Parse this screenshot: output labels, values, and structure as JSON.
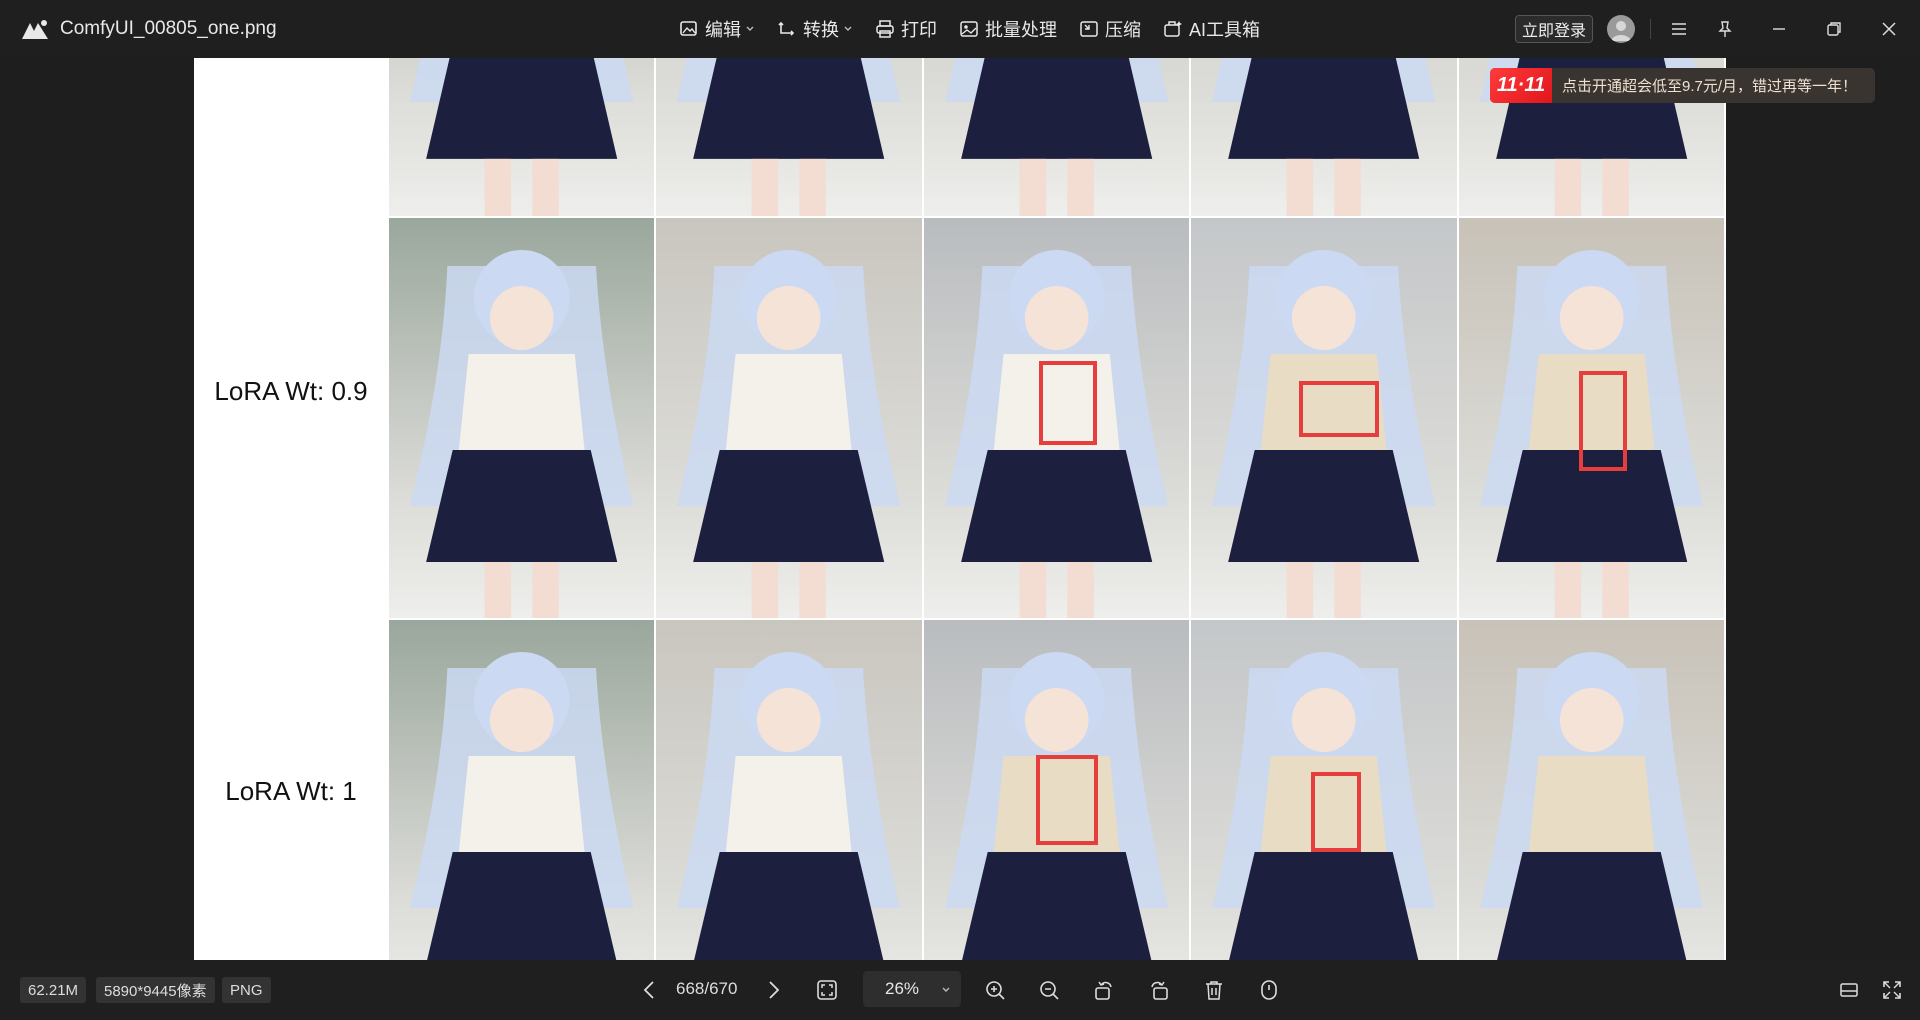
{
  "window": {
    "file_name": "ComfyUI_00805_one.png"
  },
  "toolbar": {
    "edit": "编辑",
    "convert": "转换",
    "print": "打印",
    "batch": "批量处理",
    "compress": "压缩",
    "ai_tools": "AI工具箱"
  },
  "account": {
    "login_label": "立即登录"
  },
  "promo": {
    "badge": "11·11",
    "text": "点击开通超会低至9.7元/月，错过再等一年！"
  },
  "image": {
    "row_labels": [
      "LoRA Wt: 0.9",
      "LoRA Wt: 1"
    ]
  },
  "status": {
    "file_size": "62.21M",
    "dimensions": "5890*9445像素",
    "format": "PNG",
    "page_indicator": "668/670",
    "zoom": "26%"
  },
  "icons": {
    "logo": "app-logo-icon",
    "edit": "edit-image-icon",
    "convert": "convert-icon",
    "print": "printer-icon",
    "batch": "batch-image-icon",
    "compress": "compress-icon",
    "ai_tools": "ai-toolbox-icon"
  },
  "colors": {
    "accent_red": "#e63d3d",
    "background": "#1e1e1e"
  }
}
